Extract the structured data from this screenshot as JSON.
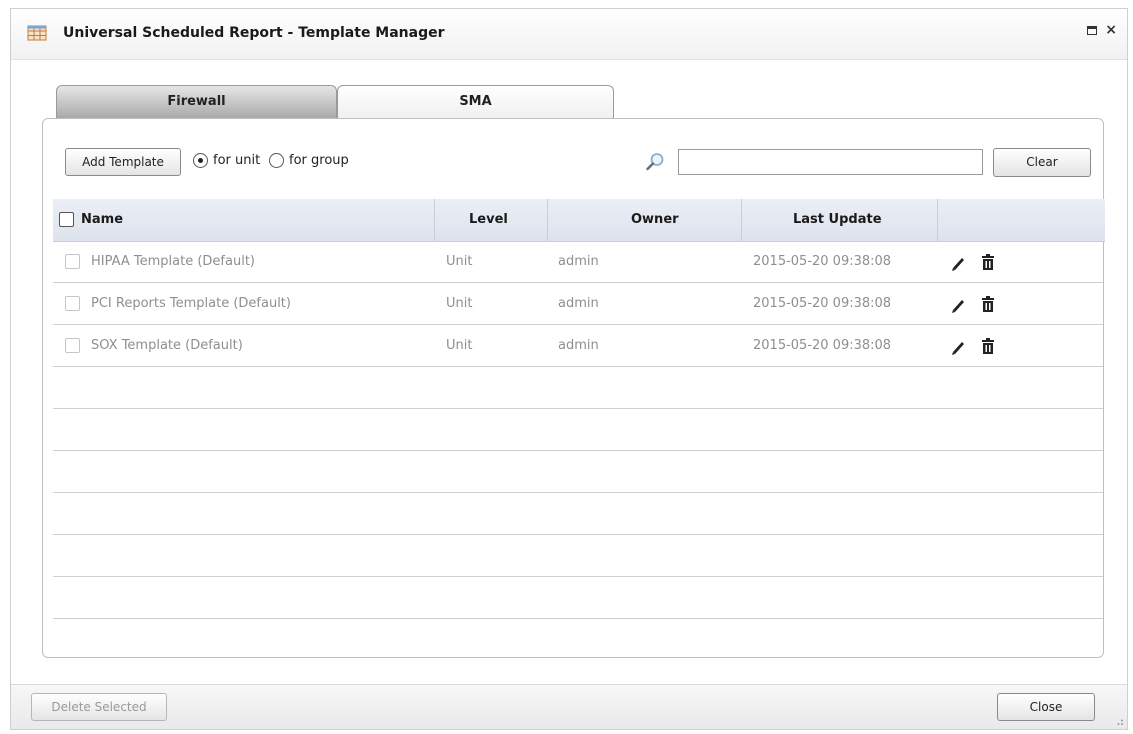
{
  "window": {
    "title": "Universal Scheduled Report - Template Manager"
  },
  "tabs": [
    {
      "label": "Firewall",
      "active": true
    },
    {
      "label": "SMA",
      "active": false
    }
  ],
  "toolbar": {
    "add_label": "Add Template",
    "radio_unit_label": "for unit",
    "radio_group_label": "for group",
    "selected_scope": "for unit",
    "search_value": "",
    "clear_label": "Clear"
  },
  "table": {
    "headers": {
      "name": "Name",
      "level": "Level",
      "owner": "Owner",
      "last_update": "Last Update"
    },
    "rows": [
      {
        "name": "HIPAA Template (Default)",
        "level": "Unit",
        "owner": "admin",
        "last_update": "2015-05-20 09:38:08"
      },
      {
        "name": "PCI Reports Template (Default)",
        "level": "Unit",
        "owner": "admin",
        "last_update": "2015-05-20 09:38:08"
      },
      {
        "name": "SOX Template (Default)",
        "level": "Unit",
        "owner": "admin",
        "last_update": "2015-05-20 09:38:08"
      }
    ],
    "row_actions": [
      "pencil-icon",
      "trash-icon"
    ]
  },
  "footer": {
    "delete_label": "Delete Selected",
    "close_label": "Close"
  },
  "colors": {
    "header_bg": "#e3e8f1",
    "active_tab": "#b8b8b8",
    "row_text": "#8f8f8f"
  }
}
